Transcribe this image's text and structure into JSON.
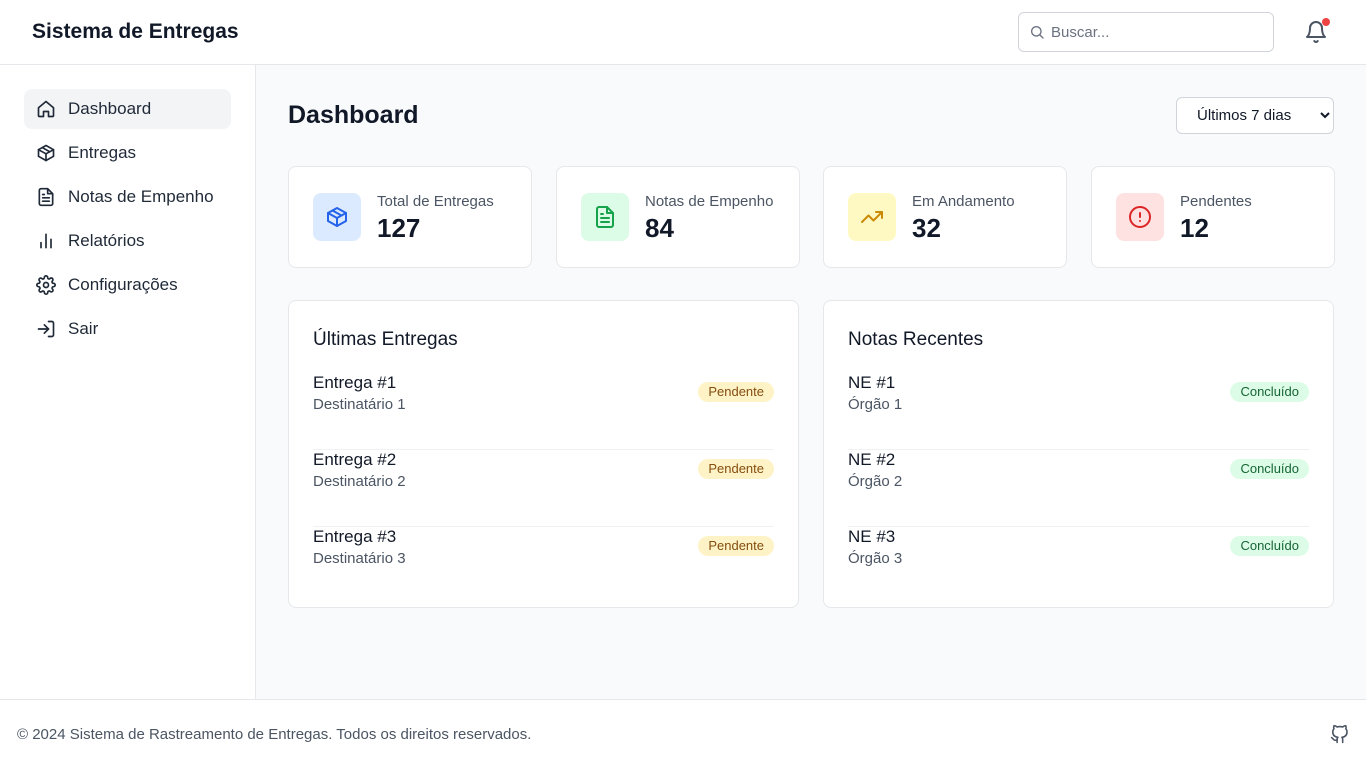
{
  "header": {
    "title": "Sistema de Entregas",
    "search_placeholder": "Buscar...",
    "search_icon": "search-icon",
    "notification_icon": "bell-icon",
    "has_notification": true
  },
  "sidebar": {
    "items": [
      {
        "label": "Dashboard",
        "icon": "home-icon",
        "active": true
      },
      {
        "label": "Entregas",
        "icon": "package-icon"
      },
      {
        "label": "Notas de Empenho",
        "icon": "file-text-icon"
      },
      {
        "label": "Relatórios",
        "icon": "bar-chart-icon"
      },
      {
        "label": "Configurações",
        "icon": "gear-icon"
      },
      {
        "label": "Sair",
        "icon": "log-in-icon"
      }
    ]
  },
  "main": {
    "title": "Dashboard",
    "period_selected": "Últimos 7 dias"
  },
  "stats": [
    {
      "label": "Total de Entregas",
      "value": "127",
      "icon": "package-icon",
      "color": "#2563eb",
      "bg": "#dbeafe"
    },
    {
      "label": "Notas de Empenho",
      "value": "84",
      "icon": "file-text-icon",
      "color": "#16a34a",
      "bg": "#dcfce7"
    },
    {
      "label": "Em Andamento",
      "value": "32",
      "icon": "trending-up-icon",
      "color": "#ca8a04",
      "bg": "#fef9c3"
    },
    {
      "label": "Pendentes",
      "value": "12",
      "icon": "alert-circle-icon",
      "color": "#dc2626",
      "bg": "#fee2e2"
    }
  ],
  "deliveries": {
    "title": "Últimas Entregas",
    "items": [
      {
        "name": "Entrega #1",
        "recipient": "Destinatário 1",
        "status": "Pendente"
      },
      {
        "name": "Entrega #2",
        "recipient": "Destinatário 2",
        "status": "Pendente"
      },
      {
        "name": "Entrega #3",
        "recipient": "Destinatário 3",
        "status": "Pendente"
      }
    ]
  },
  "notes": {
    "title": "Notas Recentes",
    "items": [
      {
        "name": "NE #1",
        "org": "Órgão 1",
        "status": "Concluído"
      },
      {
        "name": "NE #2",
        "org": "Órgão 2",
        "status": "Concluído"
      },
      {
        "name": "NE #3",
        "org": "Órgão 3",
        "status": "Concluído"
      }
    ]
  },
  "footer": {
    "copyright": "© 2024 Sistema de Rastreamento de Entregas. Todos os direitos reservados.",
    "icon": "github-icon"
  }
}
